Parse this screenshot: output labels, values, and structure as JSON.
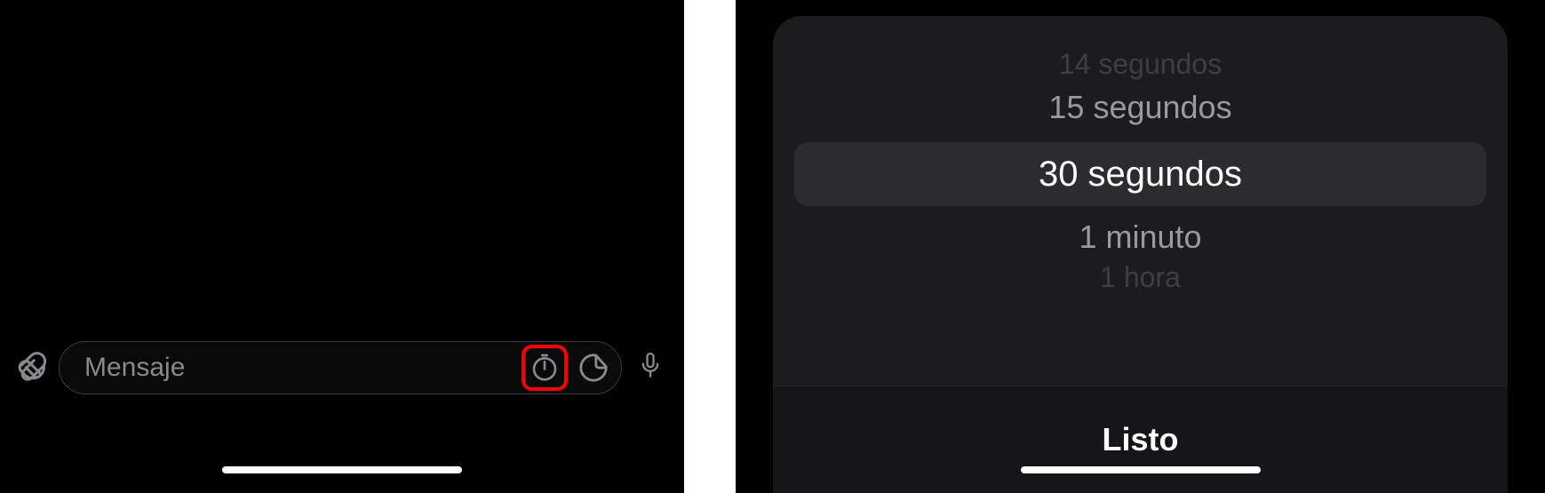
{
  "left": {
    "message_placeholder": "Mensaje"
  },
  "right": {
    "picker": {
      "options": [
        "14 segundos",
        "15 segundos",
        "30 segundos",
        "1 minuto",
        "1 hora"
      ],
      "selected_index": 2,
      "done_label": "Listo"
    }
  }
}
